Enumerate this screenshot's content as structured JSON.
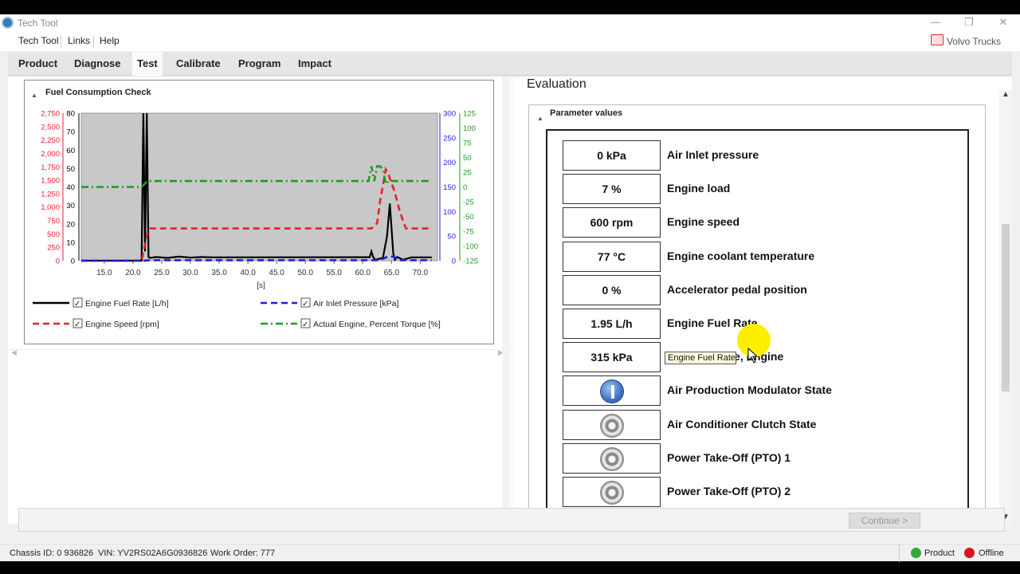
{
  "window": {
    "title": "Tech Tool",
    "minimize": "—",
    "restore": "❐",
    "close": "✕"
  },
  "menu": {
    "items": [
      "Tech Tool",
      "Links",
      "Help"
    ],
    "brand": "Volvo Trucks"
  },
  "tabs": [
    "Product",
    "Diagnose",
    "Test",
    "Calibrate",
    "Program",
    "Impact"
  ],
  "active_tab": "Test",
  "chart_panel": {
    "title": "Fuel Consumption Check",
    "collapse_icon": "triangle-up-icon"
  },
  "chart_data": {
    "type": "line",
    "title": "",
    "xlabel": "[s]",
    "xlim": [
      11,
      73
    ],
    "x_ticks": [
      "15.0",
      "20.0",
      "25.0",
      "30.0",
      "35.0",
      "40.0",
      "45.0",
      "50.0",
      "55.0",
      "60.0",
      "65.0",
      "70.0"
    ],
    "axes": {
      "engine_speed": {
        "color": "#e8202a",
        "ticks": [
          "0",
          "250",
          "500",
          "750",
          "1,000",
          "1,250",
          "1,500",
          "1,750",
          "2,000",
          "2,250",
          "2,500",
          "2,750"
        ],
        "range": [
          0,
          2750
        ]
      },
      "fuel_rate": {
        "color": "#000000",
        "ticks": [
          "0",
          "10",
          "20",
          "30",
          "40",
          "50",
          "60",
          "70",
          "80"
        ],
        "range": [
          0,
          80
        ]
      },
      "air_inlet": {
        "color": "#1f1fd8",
        "ticks": [
          "0",
          "50",
          "100",
          "150",
          "200",
          "250",
          "300"
        ],
        "range": [
          0,
          300
        ]
      },
      "torque": {
        "color": "#1f9a1f",
        "ticks": [
          "-125",
          "-100",
          "-75",
          "-50",
          "-25",
          "0",
          "25",
          "50",
          "75",
          "100",
          "125"
        ],
        "range": [
          -125,
          125
        ]
      }
    },
    "series": [
      {
        "name": "Engine Fuel Rate [L/h]",
        "axis": "fuel_rate",
        "color": "#000000",
        "dash": "solid",
        "x": [
          11,
          21.5,
          21.8,
          22.1,
          22.4,
          22.7,
          23,
          24,
          26,
          28,
          30,
          32,
          34,
          60,
          61.2,
          61.5,
          61.8,
          62.2,
          63.5,
          64.2,
          64.7,
          65.3,
          65.6,
          66,
          67,
          68.5,
          72
        ],
        "y": [
          0,
          0,
          80,
          5,
          80,
          2,
          1.5,
          2,
          1.5,
          2.2,
          1.7,
          2,
          1.8,
          1.9,
          1.9,
          5,
          1.9,
          0.5,
          1.5,
          13,
          31,
          4,
          0.5,
          2,
          0.5,
          1.8,
          1.8
        ]
      },
      {
        "name": "Engine Speed [rpm]",
        "axis": "engine_speed",
        "color": "#e8202a",
        "dash": "dashed",
        "x": [
          11,
          21.5,
          22.5,
          23,
          24,
          61.5,
          62.5,
          63,
          64,
          64.5,
          65.5,
          66.5,
          67.5,
          72
        ],
        "y": [
          0,
          0,
          500,
          600,
          600,
          600,
          700,
          1100,
          1700,
          1600,
          1300,
          900,
          600,
          600
        ]
      },
      {
        "name": "Air Inlet Pressure [kPa]",
        "axis": "air_inlet",
        "color": "#1f1fd8",
        "dash": "dashed",
        "x": [
          11,
          22,
          23,
          24,
          63,
          63.5,
          64.5,
          65.5,
          66,
          72
        ],
        "y": [
          0,
          0,
          1,
          1,
          1,
          4,
          9,
          8,
          1,
          1
        ]
      },
      {
        "name": "Actual Engine, Percent Torque [%]",
        "axis": "torque",
        "color": "#1f9a1f",
        "dash": "dashdot",
        "x": [
          11,
          21.5,
          22.5,
          23,
          30,
          60,
          61,
          61.5,
          62,
          62.5,
          63,
          63.5,
          64,
          64.5,
          65,
          66,
          72
        ],
        "y": [
          0,
          0,
          10,
          10,
          10,
          10,
          10,
          35,
          10,
          35,
          35,
          30,
          5,
          10,
          10,
          10,
          10
        ]
      }
    ],
    "legend_position": "bottom"
  },
  "legend": [
    {
      "label": "Engine Fuel Rate [L/h]",
      "checked": "✓"
    },
    {
      "label": "Air Inlet Pressure [kPa]",
      "checked": "✓"
    },
    {
      "label": "Engine Speed [rpm]",
      "checked": "✓"
    },
    {
      "label": "Actual Engine, Percent Torque [%]",
      "checked": "✓"
    }
  ],
  "evaluation": {
    "title": "Evaluation",
    "section_title": "Parameter values",
    "parameters": [
      {
        "value": "0 kPa",
        "label": "Air Inlet pressure"
      },
      {
        "value": "7 %",
        "label": "Engine load"
      },
      {
        "value": "600 rpm",
        "label": "Engine speed"
      },
      {
        "value": "77 °C",
        "label": "Engine coolant temperature"
      },
      {
        "value": "0 %",
        "label": "Accelerator pedal position"
      },
      {
        "value": "1.95 L/h",
        "label": "Engine Fuel Rate"
      },
      {
        "value": "315 kPa",
        "label": "Fuel pressure, Engine"
      },
      {
        "icon": "info-state-icon",
        "label": "Air Production Modulator State"
      },
      {
        "icon": "off-state-icon",
        "label": "Air Conditioner Clutch State"
      },
      {
        "icon": "off-state-icon",
        "label": "Power Take-Off (PTO) 1"
      },
      {
        "icon": "off-state-icon",
        "label": "Power Take-Off (PTO) 2"
      }
    ],
    "tooltip": "Engine Fuel Rate"
  },
  "continue_button": "Continue >",
  "status": {
    "chassis": "Chassis ID: 0 936826",
    "vin": "VIN: YV2RS02A6G0936826",
    "work_order": "Work Order: 777",
    "product": "Product",
    "offline": "Offline",
    "colors": {
      "product": "#2fa83a",
      "offline": "#d8141c"
    }
  }
}
